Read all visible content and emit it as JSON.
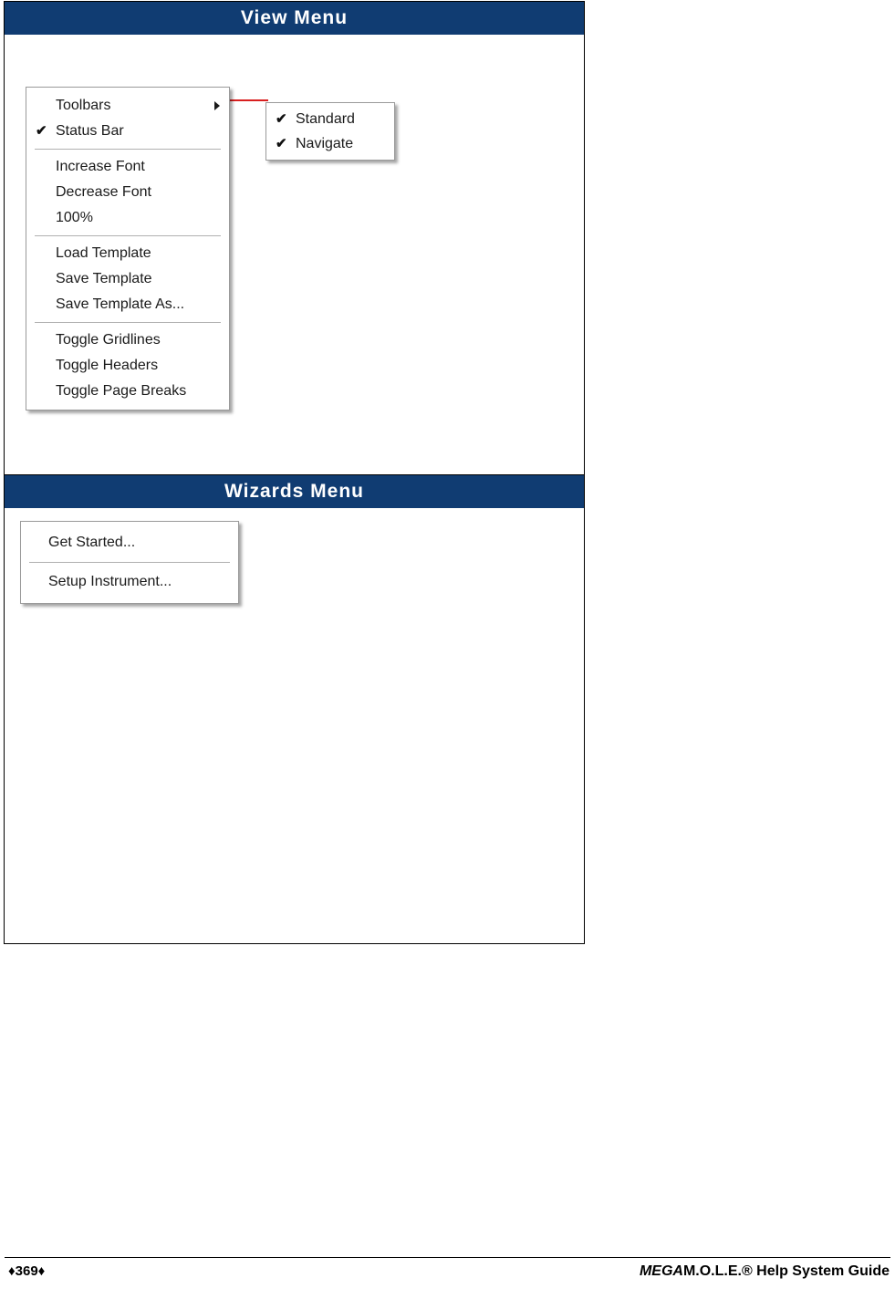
{
  "sections": [
    {
      "title": "View Menu",
      "menu": {
        "items": [
          {
            "label": "Toolbars",
            "checked": false,
            "submenu": true
          },
          {
            "label": "Status Bar",
            "checked": true,
            "submenu": false
          },
          {
            "separator": true
          },
          {
            "label": "Increase Font",
            "checked": false,
            "submenu": false
          },
          {
            "label": "Decrease Font",
            "checked": false,
            "submenu": false
          },
          {
            "label": "100%",
            "checked": false,
            "submenu": false
          },
          {
            "separator": true
          },
          {
            "label": "Load Template",
            "checked": false,
            "submenu": false
          },
          {
            "label": "Save Template",
            "checked": false,
            "submenu": false
          },
          {
            "label": "Save Template As...",
            "checked": false,
            "submenu": false
          },
          {
            "separator": true
          },
          {
            "label": "Toggle Gridlines",
            "checked": false,
            "submenu": false
          },
          {
            "label": "Toggle Headers",
            "checked": false,
            "submenu": false
          },
          {
            "label": "Toggle Page Breaks",
            "checked": false,
            "submenu": false
          }
        ]
      },
      "submenu": {
        "items": [
          {
            "label": "Standard",
            "checked": true
          },
          {
            "label": "Navigate",
            "checked": true
          }
        ]
      }
    },
    {
      "title": "Wizards Menu",
      "menu": {
        "items": [
          {
            "label": "Get Started...",
            "checked": false,
            "submenu": false
          },
          {
            "separator": true
          },
          {
            "label": "Setup Instrument...",
            "checked": false,
            "submenu": false
          }
        ]
      }
    }
  ],
  "footer": {
    "page_number": "♦369♦",
    "title_italic": "MEGA",
    "title_rest": "M.O.L.E.® Help System Guide"
  },
  "icons": {
    "checkmark": "✔",
    "submenu_arrow": "▶"
  },
  "colors": {
    "header_bg": "#103c72",
    "header_text": "#ffffff",
    "connector": "#d81f1f",
    "menu_bg": "#ffffff",
    "border": "#000000"
  }
}
